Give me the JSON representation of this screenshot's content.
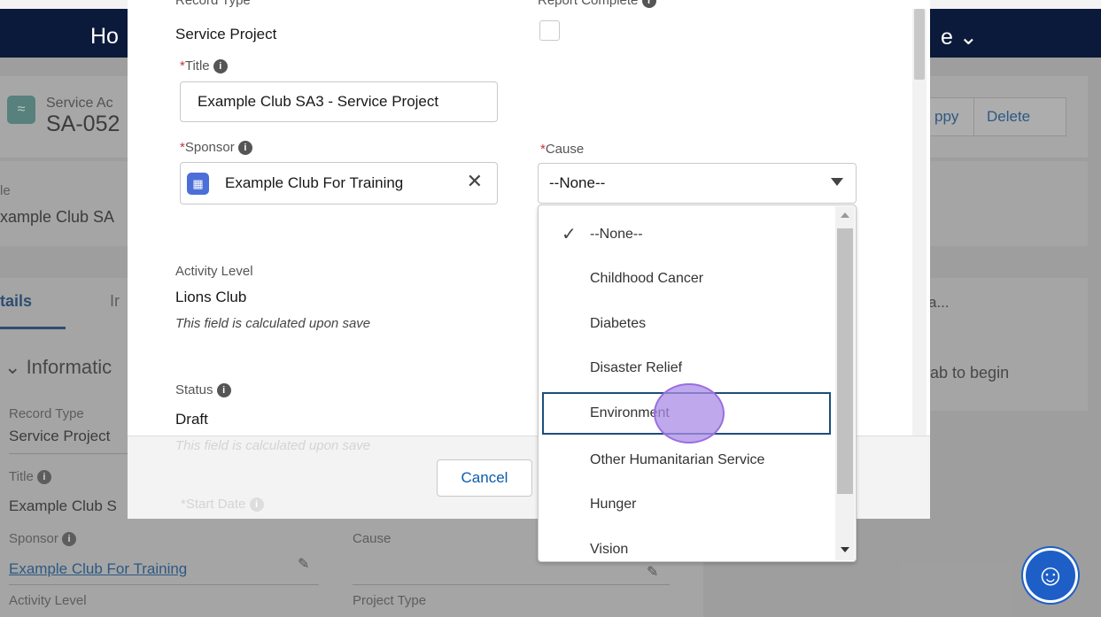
{
  "background": {
    "nav": {
      "home_label": "Ho",
      "menu_label": "e ⌄"
    },
    "record": {
      "type_label": "Service Ac",
      "number": "SA-052",
      "copy_label": "ppy",
      "delete_label": "Delete",
      "highlight_label": "le",
      "highlight_value": "xample Club SA"
    },
    "tabs": {
      "details_label": "tails",
      "second_label": "Ir"
    },
    "section": {
      "title": "Informatic"
    },
    "fields": {
      "record_type_label": "Record Type",
      "record_type_value": "Service Project",
      "title_label": "Title",
      "title_value": "Example Club S",
      "sponsor_label": "Sponsor",
      "sponsor_value": "Example Club For Training",
      "cause_label": "Cause",
      "activity_level_label": "Activity Level",
      "project_type_label": "Project Type"
    },
    "right_panel": {
      "top_text": "a...",
      "mid_text": "ab to begin"
    }
  },
  "modal": {
    "record_type_label": "Record Type",
    "record_type_value": "Service Project",
    "report_complete_label": "Report Complete",
    "title_label": "Title",
    "title_value": "Example Club SA3 - Service Project",
    "sponsor_label": "Sponsor",
    "sponsor_value": "Example Club For Training",
    "cause_label": "Cause",
    "cause_value": "--None--",
    "activity_level_label": "Activity Level",
    "activity_level_value": "Lions Club",
    "activity_level_note": "This field is calculated upon save",
    "status_label": "Status",
    "status_value": "Draft",
    "status_note": "This field is calculated upon save",
    "start_date_label": "Start Date",
    "cancel_label": "Cancel"
  },
  "dropdown": {
    "options": [
      "--None--",
      "Childhood Cancer",
      "Diabetes",
      "Disaster Relief",
      "Environment",
      "Other Humanitarian Service",
      "Hunger",
      "Vision"
    ],
    "selected": "--None--",
    "focused": "Environment"
  },
  "icons": {
    "info": "info-icon",
    "check": "checkmark-icon",
    "clear": "close-icon",
    "accessibility": "accessibility-icon"
  },
  "colors": {
    "required": "#c23934",
    "link": "#0b5cab",
    "nav": "#0b1a3a",
    "focus_border": "#1b4f7b"
  }
}
